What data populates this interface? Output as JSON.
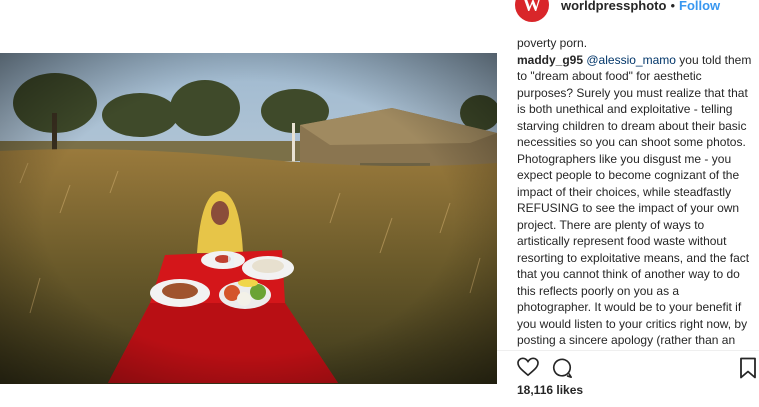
{
  "post": {
    "username": "worldpressphoto",
    "avatar_letter": "W",
    "separator": "•",
    "follow_label": "Follow",
    "accent_color": "#3897f0",
    "brand_color": "#d9262a"
  },
  "comments": [
    {
      "partial_text": "poverty porn."
    },
    {
      "user": "maddy_g95",
      "mention": "@alessio_mamo",
      "text": " you told them to \"dream about food\" for aesthetic purposes? Surely you must realize that that is both unethical and exploitative - telling starving children to dream about their basic necessities so you can shoot some photos. Photographers like you disgust me - you expect people to become cognizant of the impact of their choices, while steadfastly REFUSING to see the impact of your own project. There are plenty of ways to artistically represent food waste without resorting to exploitative means, and the fact that you cannot think of another way to do this reflects poorly on you as a photographer. It would be to your benefit if you would listen to your critics right now, by posting a sincere apology (rather than an arrogant defence) and learning from this."
    }
  ],
  "actions": {
    "like_icon": "heart-icon",
    "comment_icon": "comment-icon",
    "save_icon": "bookmark-icon"
  },
  "likes_text": "18,116 likes"
}
